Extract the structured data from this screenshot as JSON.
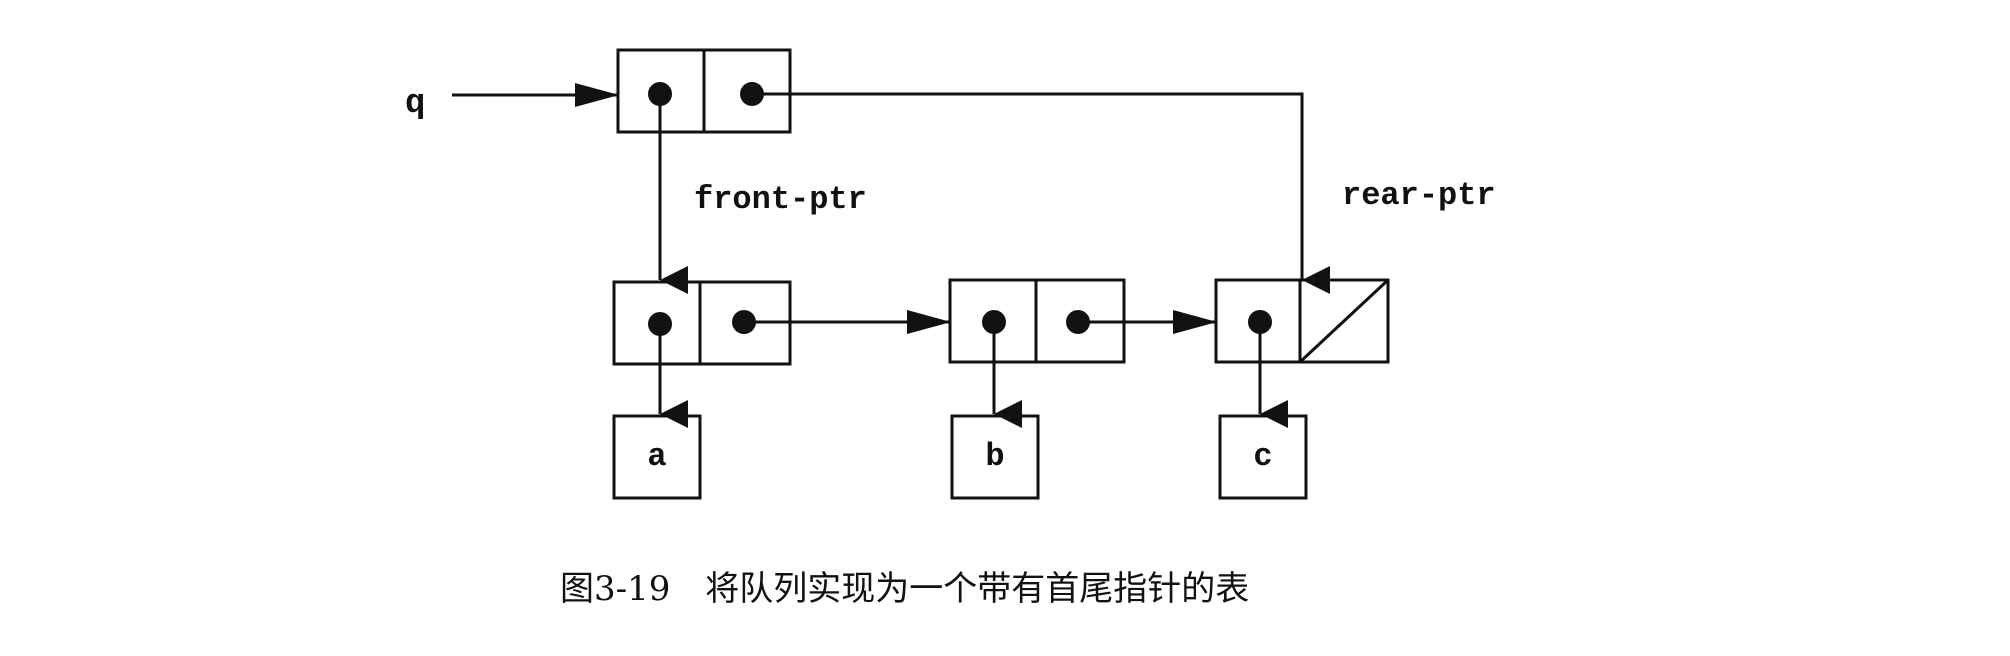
{
  "labels": {
    "q": "q",
    "front_ptr": "front-ptr",
    "rear_ptr": "rear-ptr"
  },
  "items": [
    "a",
    "b",
    "c"
  ],
  "caption": {
    "figure": "图3-19",
    "text": "将队列实现为一个带有首尾指针的表"
  }
}
